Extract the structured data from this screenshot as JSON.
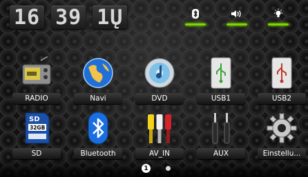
{
  "status_bar": {
    "hour": "16",
    "minute": "39",
    "seconds": "1Ų",
    "indicators": [
      "bluetooth-icon",
      "speaker-icon",
      "brightness-icon"
    ]
  },
  "apps": [
    {
      "label": "RADIO",
      "icon": "radio-icon"
    },
    {
      "label": "Navi",
      "icon": "globe-icon"
    },
    {
      "label": "DVD",
      "icon": "disc-icon"
    },
    {
      "label": "USB1",
      "icon": "usb-icon"
    },
    {
      "label": "USB2",
      "icon": "usb-icon"
    },
    {
      "label": "SD",
      "icon": "sd-card-icon",
      "card_text": "32GB"
    },
    {
      "label": "Bluetooth",
      "icon": "bluetooth-icon"
    },
    {
      "label": "AV_IN",
      "icon": "rca-plug-icon"
    },
    {
      "label": "AUX",
      "icon": "aux-plug-icon"
    },
    {
      "label": "Einstellu...",
      "icon": "settings-gear-icon"
    }
  ],
  "sd_brand": "SD",
  "pager": {
    "current": "1",
    "total": 2
  },
  "colors": {
    "indicator_active": "#7ad500"
  }
}
